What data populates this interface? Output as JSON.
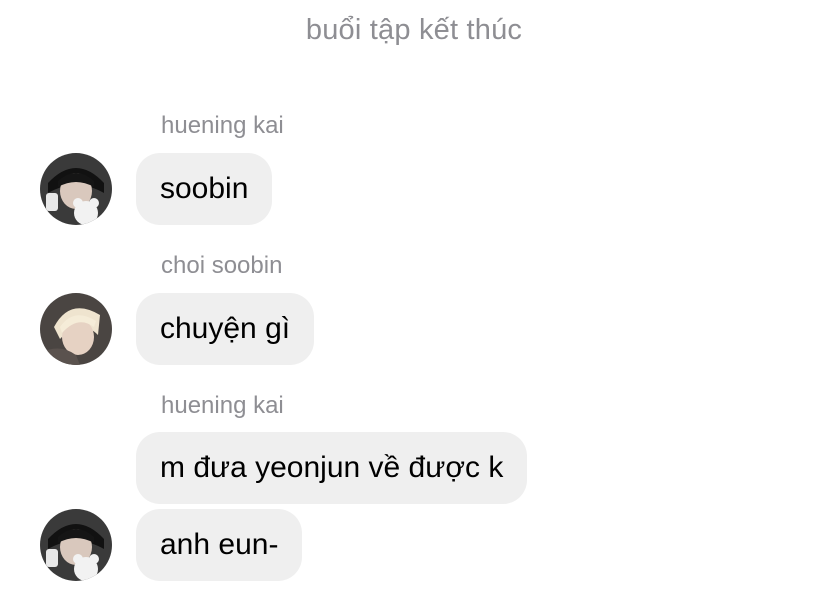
{
  "chat": {
    "system_message": "buổi tập kết thúc"
  },
  "messages": [
    {
      "sender": "huening kai",
      "text": "soobin"
    },
    {
      "sender": "choi soobin",
      "text": "chuyện gì"
    },
    {
      "sender": "huening kai",
      "text": "m đưa yeonjun về được k"
    },
    {
      "text": "anh eun-"
    }
  ],
  "colors": {
    "bubble_bg": "#efefef",
    "meta_text": "#8e8e93",
    "message_text": "#000000"
  }
}
